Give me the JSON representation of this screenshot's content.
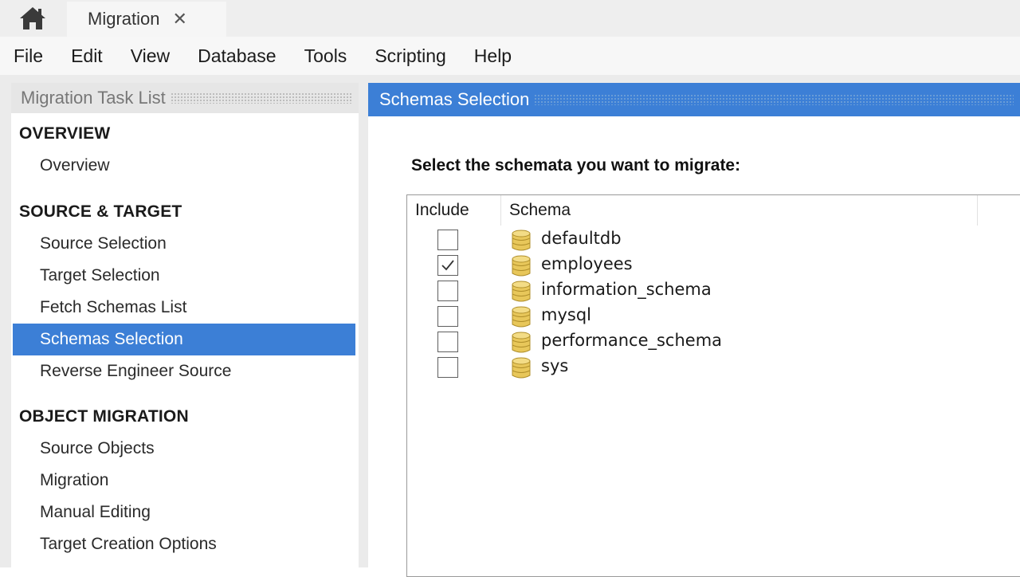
{
  "tab": {
    "home_icon": "home-icon",
    "title": "Migration",
    "close_glyph": "✕"
  },
  "menu": [
    "File",
    "Edit",
    "View",
    "Database",
    "Tools",
    "Scripting",
    "Help"
  ],
  "task_list": {
    "title": "Migration Task List",
    "sections": [
      {
        "heading": "OVERVIEW",
        "items": [
          "Overview"
        ]
      },
      {
        "heading": "SOURCE & TARGET",
        "items": [
          "Source Selection",
          "Target Selection",
          "Fetch Schemas List",
          "Schemas Selection",
          "Reverse Engineer Source"
        ]
      },
      {
        "heading": "OBJECT MIGRATION",
        "items": [
          "Source Objects",
          "Migration",
          "Manual Editing",
          "Target Creation Options"
        ]
      }
    ],
    "selected": "Schemas Selection"
  },
  "content": {
    "title": "Schemas Selection",
    "instruction": "Select the schemata you want to migrate:",
    "columns": {
      "include": "Include",
      "schema": "Schema"
    },
    "schemas": [
      {
        "name": "defaultdb",
        "included": false
      },
      {
        "name": "employees",
        "included": true
      },
      {
        "name": "information_schema",
        "included": false
      },
      {
        "name": "mysql",
        "included": false
      },
      {
        "name": "performance_schema",
        "included": false
      },
      {
        "name": "sys",
        "included": false
      }
    ]
  },
  "colors": {
    "accent": "#3c7fd6",
    "db_icon": "#e8c75a"
  }
}
